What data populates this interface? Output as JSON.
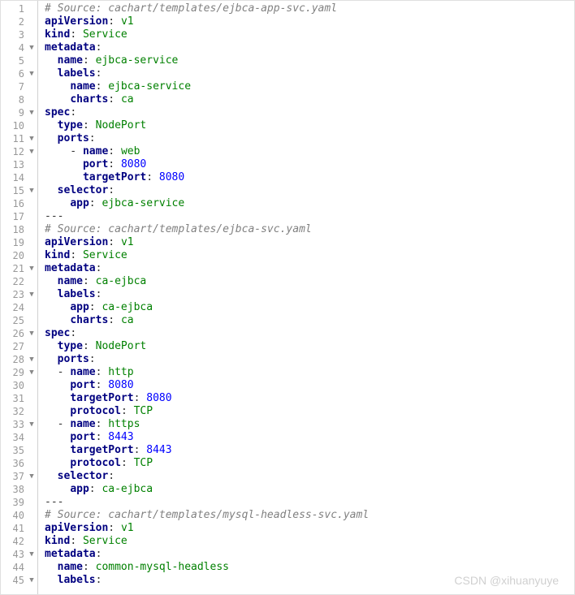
{
  "watermark": "CSDN @xihuanyuye",
  "lines": [
    {
      "n": 1,
      "fold": "",
      "tokens": [
        {
          "t": "# Source: cachart/templates/ejbca-app-svc.yaml",
          "c": "comment"
        }
      ]
    },
    {
      "n": 2,
      "fold": "",
      "tokens": [
        {
          "t": "apiVersion",
          "c": "key"
        },
        {
          "t": ": ",
          "c": "colon"
        },
        {
          "t": "v1",
          "c": "string"
        }
      ]
    },
    {
      "n": 3,
      "fold": "",
      "tokens": [
        {
          "t": "kind",
          "c": "key"
        },
        {
          "t": ": ",
          "c": "colon"
        },
        {
          "t": "Service",
          "c": "string"
        }
      ]
    },
    {
      "n": 4,
      "fold": "▼",
      "tokens": [
        {
          "t": "metadata",
          "c": "key"
        },
        {
          "t": ":",
          "c": "colon"
        }
      ]
    },
    {
      "n": 5,
      "fold": "",
      "tokens": [
        {
          "t": "  ",
          "c": ""
        },
        {
          "t": "name",
          "c": "key"
        },
        {
          "t": ": ",
          "c": "colon"
        },
        {
          "t": "ejbca-service",
          "c": "string"
        }
      ]
    },
    {
      "n": 6,
      "fold": "▼",
      "tokens": [
        {
          "t": "  ",
          "c": ""
        },
        {
          "t": "labels",
          "c": "key"
        },
        {
          "t": ":",
          "c": "colon"
        }
      ]
    },
    {
      "n": 7,
      "fold": "",
      "tokens": [
        {
          "t": "    ",
          "c": ""
        },
        {
          "t": "name",
          "c": "key"
        },
        {
          "t": ": ",
          "c": "colon"
        },
        {
          "t": "ejbca-service",
          "c": "string"
        }
      ]
    },
    {
      "n": 8,
      "fold": "",
      "tokens": [
        {
          "t": "    ",
          "c": ""
        },
        {
          "t": "charts",
          "c": "key"
        },
        {
          "t": ": ",
          "c": "colon"
        },
        {
          "t": "ca",
          "c": "string"
        }
      ]
    },
    {
      "n": 9,
      "fold": "▼",
      "tokens": [
        {
          "t": "spec",
          "c": "key"
        },
        {
          "t": ":",
          "c": "colon"
        }
      ]
    },
    {
      "n": 10,
      "fold": "",
      "tokens": [
        {
          "t": "  ",
          "c": ""
        },
        {
          "t": "type",
          "c": "key"
        },
        {
          "t": ": ",
          "c": "colon"
        },
        {
          "t": "NodePort",
          "c": "string"
        }
      ]
    },
    {
      "n": 11,
      "fold": "▼",
      "tokens": [
        {
          "t": "  ",
          "c": ""
        },
        {
          "t": "ports",
          "c": "key"
        },
        {
          "t": ":",
          "c": "colon"
        }
      ]
    },
    {
      "n": 12,
      "fold": "▼",
      "tokens": [
        {
          "t": "    - ",
          "c": "dash"
        },
        {
          "t": "name",
          "c": "key"
        },
        {
          "t": ": ",
          "c": "colon"
        },
        {
          "t": "web",
          "c": "string"
        }
      ]
    },
    {
      "n": 13,
      "fold": "",
      "tokens": [
        {
          "t": "      ",
          "c": ""
        },
        {
          "t": "port",
          "c": "key"
        },
        {
          "t": ": ",
          "c": "colon"
        },
        {
          "t": "8080",
          "c": "number"
        }
      ]
    },
    {
      "n": 14,
      "fold": "",
      "tokens": [
        {
          "t": "      ",
          "c": ""
        },
        {
          "t": "targetPort",
          "c": "key"
        },
        {
          "t": ": ",
          "c": "colon"
        },
        {
          "t": "8080",
          "c": "number"
        }
      ]
    },
    {
      "n": 15,
      "fold": "▼",
      "tokens": [
        {
          "t": "  ",
          "c": ""
        },
        {
          "t": "selector",
          "c": "key"
        },
        {
          "t": ":",
          "c": "colon"
        }
      ]
    },
    {
      "n": 16,
      "fold": "",
      "tokens": [
        {
          "t": "    ",
          "c": ""
        },
        {
          "t": "app",
          "c": "key"
        },
        {
          "t": ": ",
          "c": "colon"
        },
        {
          "t": "ejbca-service",
          "c": "string"
        }
      ]
    },
    {
      "n": 17,
      "fold": "",
      "tokens": [
        {
          "t": "---",
          "c": "dash"
        }
      ]
    },
    {
      "n": 18,
      "fold": "",
      "tokens": [
        {
          "t": "# Source: cachart/templates/ejbca-svc.yaml",
          "c": "comment"
        }
      ]
    },
    {
      "n": 19,
      "fold": "",
      "tokens": [
        {
          "t": "apiVersion",
          "c": "key"
        },
        {
          "t": ": ",
          "c": "colon"
        },
        {
          "t": "v1",
          "c": "string"
        }
      ]
    },
    {
      "n": 20,
      "fold": "",
      "tokens": [
        {
          "t": "kind",
          "c": "key"
        },
        {
          "t": ": ",
          "c": "colon"
        },
        {
          "t": "Service",
          "c": "string"
        }
      ]
    },
    {
      "n": 21,
      "fold": "▼",
      "tokens": [
        {
          "t": "metadata",
          "c": "key"
        },
        {
          "t": ":",
          "c": "colon"
        }
      ]
    },
    {
      "n": 22,
      "fold": "",
      "tokens": [
        {
          "t": "  ",
          "c": ""
        },
        {
          "t": "name",
          "c": "key"
        },
        {
          "t": ": ",
          "c": "colon"
        },
        {
          "t": "ca-ejbca",
          "c": "string"
        }
      ]
    },
    {
      "n": 23,
      "fold": "▼",
      "tokens": [
        {
          "t": "  ",
          "c": ""
        },
        {
          "t": "labels",
          "c": "key"
        },
        {
          "t": ":",
          "c": "colon"
        }
      ]
    },
    {
      "n": 24,
      "fold": "",
      "tokens": [
        {
          "t": "    ",
          "c": ""
        },
        {
          "t": "app",
          "c": "key"
        },
        {
          "t": ": ",
          "c": "colon"
        },
        {
          "t": "ca-ejbca",
          "c": "string"
        }
      ]
    },
    {
      "n": 25,
      "fold": "",
      "tokens": [
        {
          "t": "    ",
          "c": ""
        },
        {
          "t": "charts",
          "c": "key"
        },
        {
          "t": ": ",
          "c": "colon"
        },
        {
          "t": "ca",
          "c": "string"
        }
      ]
    },
    {
      "n": 26,
      "fold": "▼",
      "tokens": [
        {
          "t": "spec",
          "c": "key"
        },
        {
          "t": ":",
          "c": "colon"
        }
      ]
    },
    {
      "n": 27,
      "fold": "",
      "tokens": [
        {
          "t": "  ",
          "c": ""
        },
        {
          "t": "type",
          "c": "key"
        },
        {
          "t": ": ",
          "c": "colon"
        },
        {
          "t": "NodePort",
          "c": "string"
        }
      ]
    },
    {
      "n": 28,
      "fold": "▼",
      "tokens": [
        {
          "t": "  ",
          "c": ""
        },
        {
          "t": "ports",
          "c": "key"
        },
        {
          "t": ":",
          "c": "colon"
        }
      ]
    },
    {
      "n": 29,
      "fold": "▼",
      "tokens": [
        {
          "t": "  - ",
          "c": "dash"
        },
        {
          "t": "name",
          "c": "key"
        },
        {
          "t": ": ",
          "c": "colon"
        },
        {
          "t": "http",
          "c": "string"
        }
      ]
    },
    {
      "n": 30,
      "fold": "",
      "tokens": [
        {
          "t": "    ",
          "c": ""
        },
        {
          "t": "port",
          "c": "key"
        },
        {
          "t": ": ",
          "c": "colon"
        },
        {
          "t": "8080",
          "c": "number"
        }
      ]
    },
    {
      "n": 31,
      "fold": "",
      "tokens": [
        {
          "t": "    ",
          "c": ""
        },
        {
          "t": "targetPort",
          "c": "key"
        },
        {
          "t": ": ",
          "c": "colon"
        },
        {
          "t": "8080",
          "c": "number"
        }
      ]
    },
    {
      "n": 32,
      "fold": "",
      "tokens": [
        {
          "t": "    ",
          "c": ""
        },
        {
          "t": "protocol",
          "c": "key"
        },
        {
          "t": ": ",
          "c": "colon"
        },
        {
          "t": "TCP",
          "c": "string"
        }
      ]
    },
    {
      "n": 33,
      "fold": "▼",
      "tokens": [
        {
          "t": "  - ",
          "c": "dash"
        },
        {
          "t": "name",
          "c": "key"
        },
        {
          "t": ": ",
          "c": "colon"
        },
        {
          "t": "https",
          "c": "string"
        }
      ]
    },
    {
      "n": 34,
      "fold": "",
      "tokens": [
        {
          "t": "    ",
          "c": ""
        },
        {
          "t": "port",
          "c": "key"
        },
        {
          "t": ": ",
          "c": "colon"
        },
        {
          "t": "8443",
          "c": "number"
        }
      ]
    },
    {
      "n": 35,
      "fold": "",
      "tokens": [
        {
          "t": "    ",
          "c": ""
        },
        {
          "t": "targetPort",
          "c": "key"
        },
        {
          "t": ": ",
          "c": "colon"
        },
        {
          "t": "8443",
          "c": "number"
        }
      ]
    },
    {
      "n": 36,
      "fold": "",
      "tokens": [
        {
          "t": "    ",
          "c": ""
        },
        {
          "t": "protocol",
          "c": "key"
        },
        {
          "t": ": ",
          "c": "colon"
        },
        {
          "t": "TCP",
          "c": "string"
        }
      ]
    },
    {
      "n": 37,
      "fold": "▼",
      "tokens": [
        {
          "t": "  ",
          "c": ""
        },
        {
          "t": "selector",
          "c": "key"
        },
        {
          "t": ":",
          "c": "colon"
        }
      ]
    },
    {
      "n": 38,
      "fold": "",
      "tokens": [
        {
          "t": "    ",
          "c": ""
        },
        {
          "t": "app",
          "c": "key"
        },
        {
          "t": ": ",
          "c": "colon"
        },
        {
          "t": "ca-ejbca",
          "c": "string"
        }
      ]
    },
    {
      "n": 39,
      "fold": "",
      "tokens": [
        {
          "t": "---",
          "c": "dash"
        }
      ]
    },
    {
      "n": 40,
      "fold": "",
      "tokens": [
        {
          "t": "# Source: cachart/templates/mysql-headless-svc.yaml",
          "c": "comment"
        }
      ]
    },
    {
      "n": 41,
      "fold": "",
      "tokens": [
        {
          "t": "apiVersion",
          "c": "key"
        },
        {
          "t": ": ",
          "c": "colon"
        },
        {
          "t": "v1",
          "c": "string"
        }
      ]
    },
    {
      "n": 42,
      "fold": "",
      "tokens": [
        {
          "t": "kind",
          "c": "key"
        },
        {
          "t": ": ",
          "c": "colon"
        },
        {
          "t": "Service",
          "c": "string"
        }
      ]
    },
    {
      "n": 43,
      "fold": "▼",
      "tokens": [
        {
          "t": "metadata",
          "c": "key"
        },
        {
          "t": ":",
          "c": "colon"
        }
      ]
    },
    {
      "n": 44,
      "fold": "",
      "tokens": [
        {
          "t": "  ",
          "c": ""
        },
        {
          "t": "name",
          "c": "key"
        },
        {
          "t": ": ",
          "c": "colon"
        },
        {
          "t": "common-mysql-headless",
          "c": "string"
        }
      ]
    },
    {
      "n": 45,
      "fold": "▼",
      "tokens": [
        {
          "t": "  ",
          "c": ""
        },
        {
          "t": "labels",
          "c": "key"
        },
        {
          "t": ":",
          "c": "colon"
        }
      ]
    }
  ]
}
